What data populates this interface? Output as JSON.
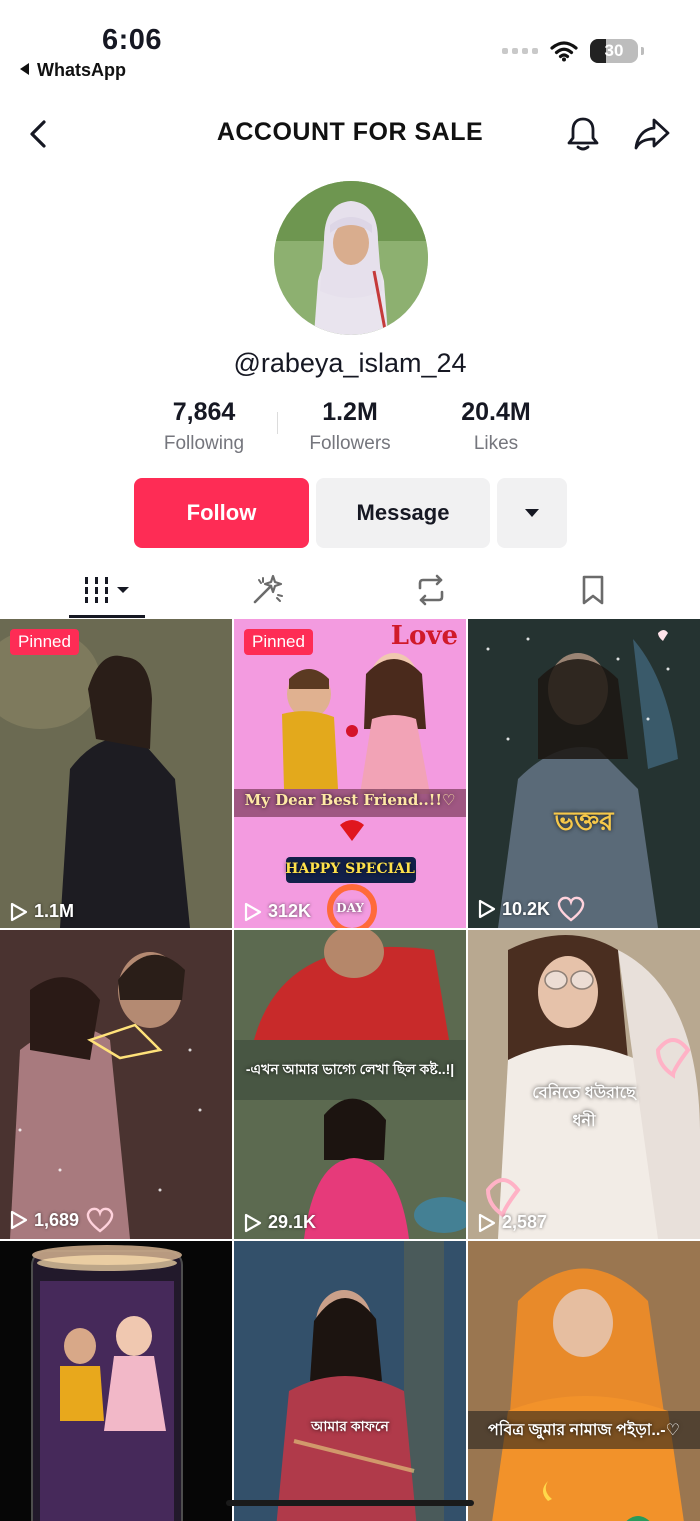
{
  "status": {
    "time": "6:06",
    "back_app": "WhatsApp",
    "battery": "30"
  },
  "nav": {
    "title": "ACCOUNT FOR SALE",
    "icons": [
      "back-chevron-icon",
      "bell-icon",
      "share-icon"
    ]
  },
  "profile": {
    "username": "@rabeya_islam_24",
    "stats": [
      {
        "value": "7,864",
        "label": "Following"
      },
      {
        "value": "1.2M",
        "label": "Followers"
      },
      {
        "value": "20.4M",
        "label": "Likes"
      }
    ],
    "follow_label": "Follow",
    "message_label": "Message",
    "colors": {
      "follow": "#fe2c55",
      "secondary_button": "#f1f1f2"
    }
  },
  "tabs": {
    "icons": [
      "videos-grid-icon",
      "reposts-sparkle-icon",
      "repost-icon",
      "bookmark-icon"
    ],
    "active": 0
  },
  "videos": [
    {
      "pinned": "Pinned",
      "views": "1.1M"
    },
    {
      "pinned": "Pinned",
      "views": "312K",
      "caption_top": "Love",
      "caption": "My Dear Best Friend..!!♡",
      "caption2": "HAPPY SPECIAL",
      "caption3": "DAY"
    },
    {
      "views": "10.2K",
      "caption": "ভক্তর"
    },
    {
      "views": "1,689"
    },
    {
      "views": "29.1K",
      "caption": "-এখন আমার ভাগ্যে লেখা ছিল কষ্ট..!|"
    },
    {
      "views": "2,587",
      "caption": "বেনিতে ধউরাছে",
      "caption2": "ধনী"
    },
    {
      "views": ""
    },
    {
      "views": "",
      "caption": "আমার কাফনে"
    },
    {
      "views": "",
      "caption": "পবিত্র জুমার নামাজ পইড়া..-♡"
    }
  ]
}
